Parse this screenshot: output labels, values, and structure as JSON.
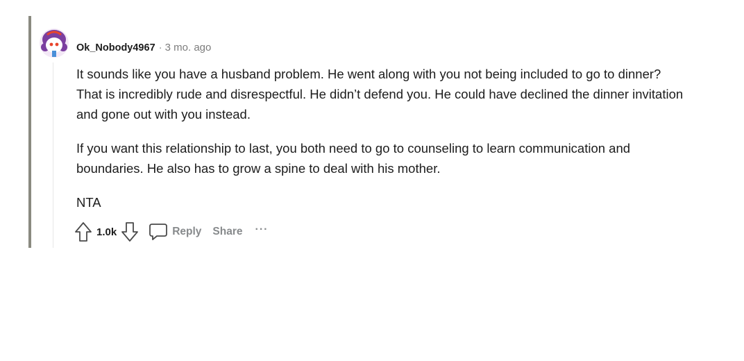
{
  "comment": {
    "username": "Ok_Nobody4967",
    "separator": "·",
    "timestamp": "3 mo. ago",
    "paragraphs": [
      "It sounds like you have a husband problem. He went along with you not being included to go to dinner? That is incredibly rude and disrespectful. He didn’t defend you. He could have declined the dinner invitation and gone out with you instead.",
      "If you want this relationship to last, you both need to go to counseling to learn communication and boundaries. He also has to grow a spine to deal with his mother.",
      "NTA"
    ],
    "actions": {
      "vote_count": "1.0k",
      "reply_label": "Reply",
      "share_label": "Share",
      "more_label": "···"
    }
  },
  "colors": {
    "thread_bar": "#8a8a80",
    "avatar_hair": "#7b3fa0",
    "avatar_bg": "#f3e8f6",
    "meta_gray": "#878a8c"
  },
  "icons": {
    "upvote": "arrow-up-outline-icon",
    "downvote": "arrow-down-outline-icon",
    "reply": "comment-bubble-icon"
  }
}
